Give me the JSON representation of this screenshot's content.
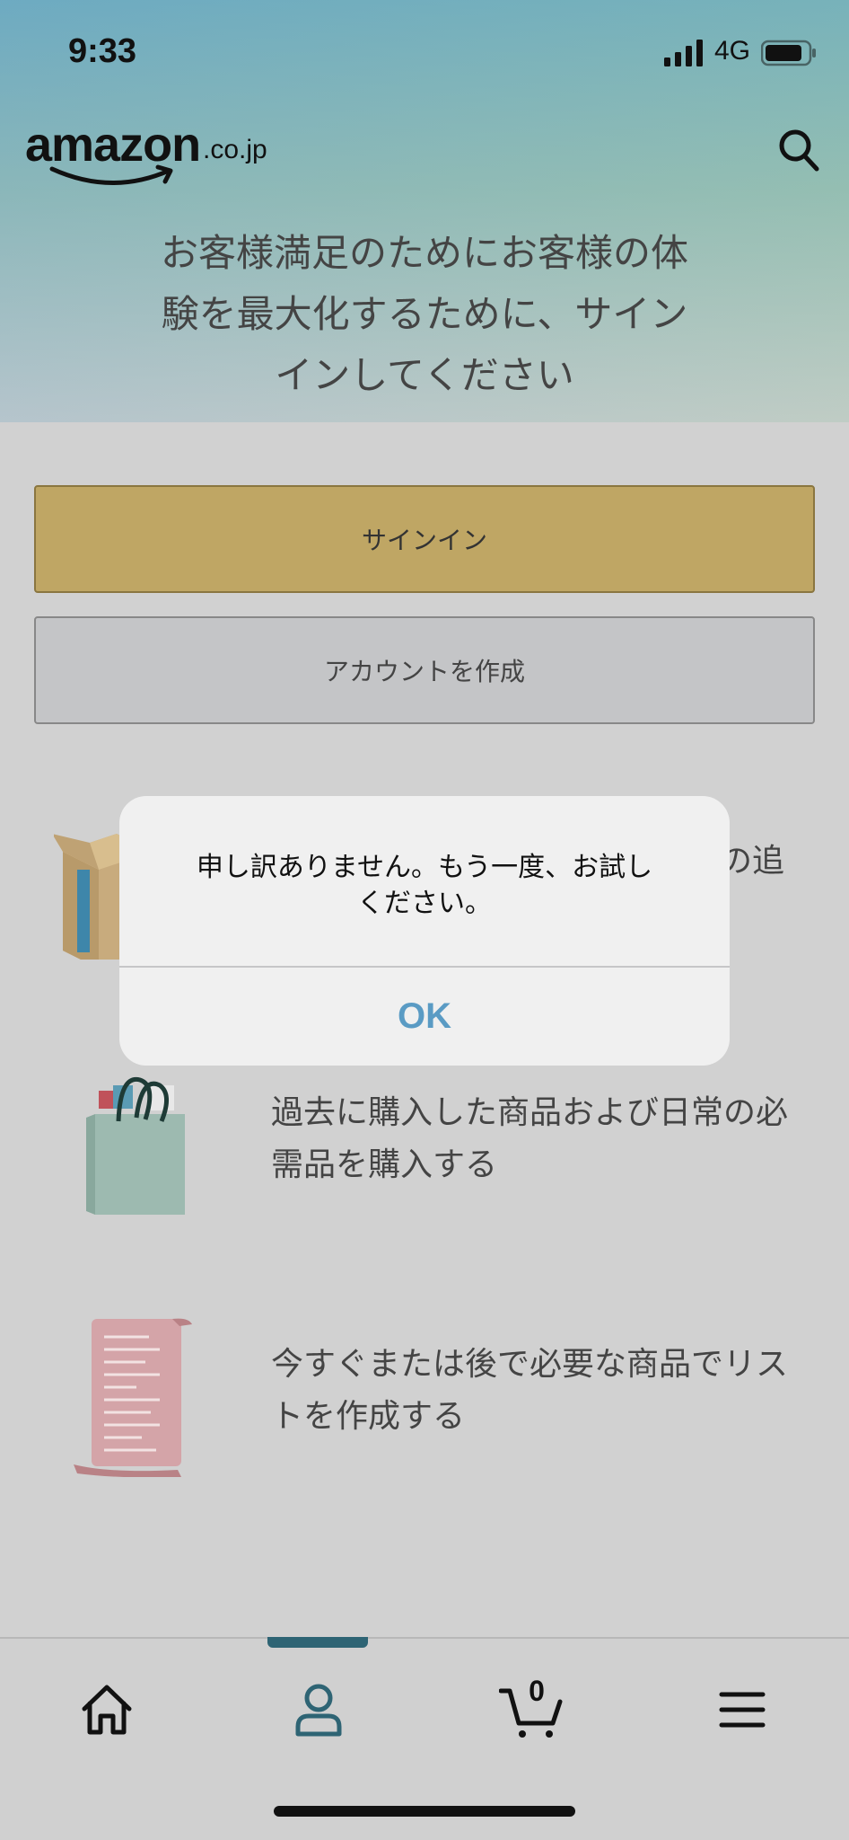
{
  "status_bar": {
    "time": "9:33",
    "network": "4G"
  },
  "header": {
    "logo_main": "amazon",
    "logo_tld": ".co.jp",
    "search_icon": "search-icon"
  },
  "headline": {
    "line1": "お客様満足のためにお客様の体",
    "line2": "験を最大化するために、サイン",
    "line3": "インしてください"
  },
  "buttons": {
    "signin_label": "サインイン",
    "create_account_label": "アカウントを作成"
  },
  "features": [
    {
      "icon": "box-icon",
      "line1": "",
      "line2": "",
      "partial_visible": "の追"
    },
    {
      "icon": "shopping-bag-icon",
      "line1": "過去に購入した商品および日常の必",
      "line2": "需品を購入する"
    },
    {
      "icon": "list-scroll-icon",
      "line1": "今すぐまたは後で必要な商品でリス",
      "line2": "トを作成する"
    }
  ],
  "dialog": {
    "message_line1": "申し訳ありません。もう一度、お試し",
    "message_line2": "ください。",
    "ok_label": "OK"
  },
  "tabbar": {
    "items": [
      {
        "name": "home",
        "icon": "home-icon"
      },
      {
        "name": "account",
        "icon": "person-icon",
        "active": true
      },
      {
        "name": "cart",
        "icon": "cart-icon",
        "count": "0"
      },
      {
        "name": "menu",
        "icon": "hamburger-icon"
      }
    ]
  },
  "colors": {
    "signin_button": "#bfa664",
    "active_tab": "#2e6474",
    "dialog_ok": "#5a9bc4"
  }
}
